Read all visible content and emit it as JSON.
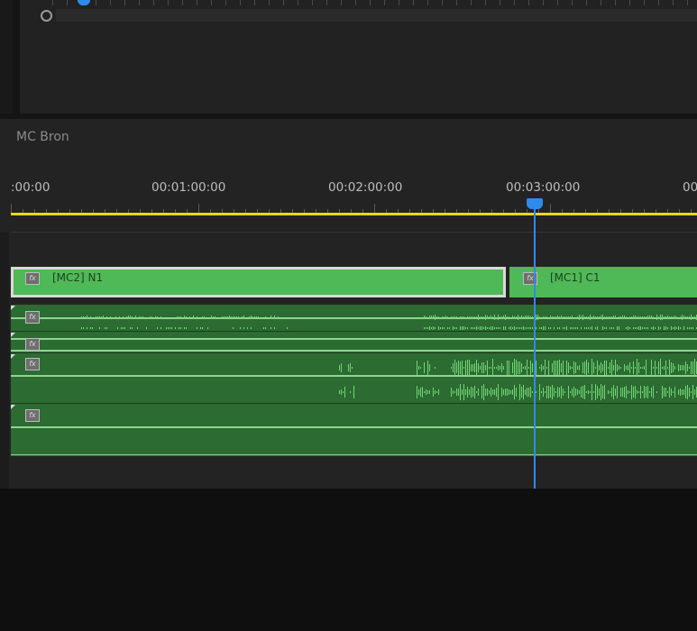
{
  "sequence": {
    "name": "MC Bron"
  },
  "ruler": {
    "timecodes": [
      ":00:00",
      "00:01:00:00",
      "00:02:00:00",
      "00:03:00:00",
      "00"
    ],
    "playhead_timecode": "00:03:00:00"
  },
  "clips": {
    "video": [
      {
        "label": "[MC2] N1",
        "fx": "fx",
        "selected": true
      },
      {
        "label": "[MC1] C1",
        "fx": "fx",
        "selected": false
      }
    ],
    "audio": [
      {
        "fx": "fx"
      },
      {
        "fx": "fx"
      },
      {
        "fx": "fx"
      },
      {
        "fx": "fx"
      }
    ]
  },
  "colors": {
    "clip_green": "#4fb957",
    "audio_green": "#2c6b32",
    "waveform": "#72d476",
    "playhead": "#2d8ceb",
    "work_area": "#e6d61f"
  },
  "icons": [
    "fx-badge-icon",
    "playhead-icon",
    "zoom-handle-icon"
  ]
}
